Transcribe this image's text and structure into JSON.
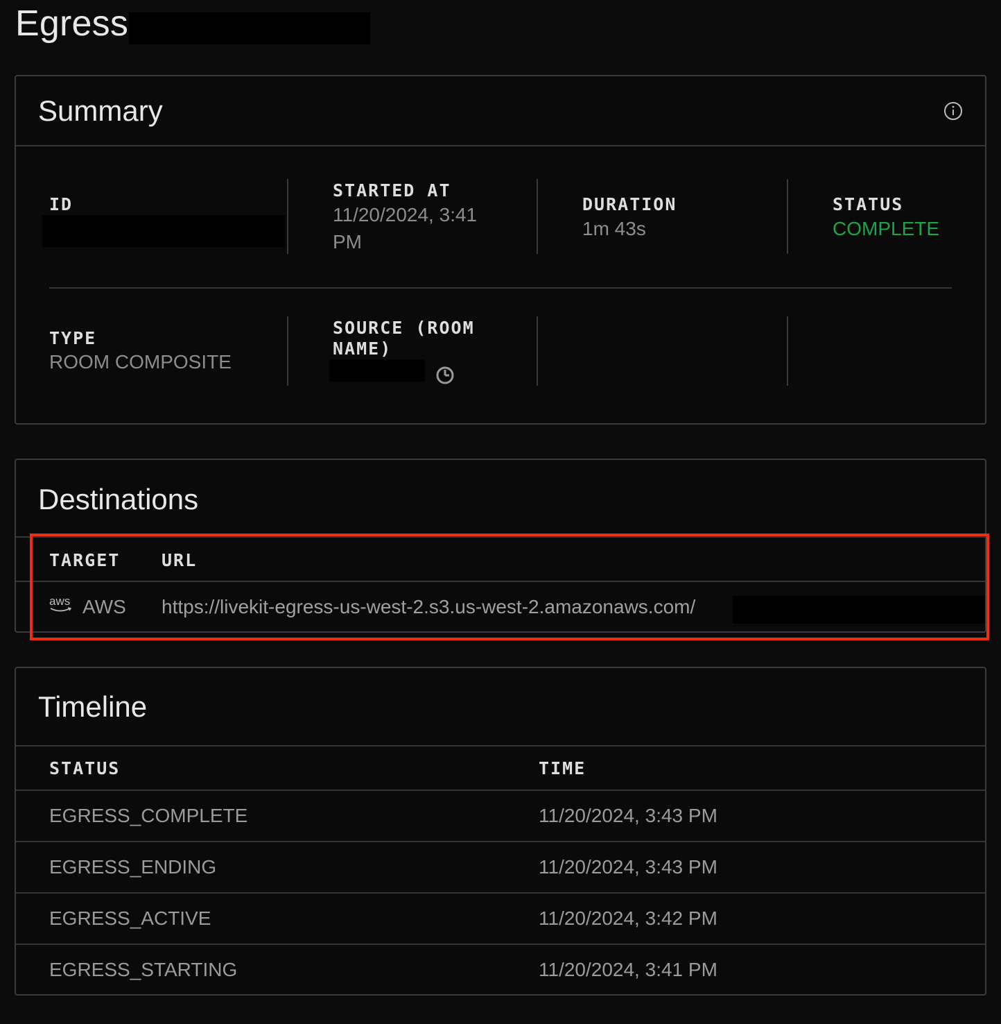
{
  "header": {
    "title": "Egress"
  },
  "summary": {
    "title": "Summary",
    "info_icon": "info-icon",
    "id_label": "ID",
    "started_label": "STARTED AT",
    "started_value_line1": "11/20/2024, 3:41",
    "started_value_line2": "PM",
    "duration_label": "DURATION",
    "duration_value": "1m 43s",
    "status_label": "STATUS",
    "status_value": "COMPLETE",
    "status_color": "#1fa34a",
    "type_label": "TYPE",
    "type_value": "ROOM COMPOSITE",
    "source_label_line1": "SOURCE (ROOM",
    "source_label_line2": "NAME)",
    "source_icon": "clock-icon"
  },
  "destinations": {
    "title": "Destinations",
    "columns": [
      "TARGET",
      "URL"
    ],
    "rows": [
      {
        "logo": "aws",
        "target": "AWS",
        "url": "https://livekit-egress-us-west-2.s3.us-west-2.amazonaws.com/"
      }
    ]
  },
  "timeline": {
    "title": "Timeline",
    "columns": [
      "STATUS",
      "TIME"
    ],
    "rows": [
      {
        "status": "EGRESS_COMPLETE",
        "time": "11/20/2024, 3:43 PM"
      },
      {
        "status": "EGRESS_ENDING",
        "time": "11/20/2024, 3:43 PM"
      },
      {
        "status": "EGRESS_ACTIVE",
        "time": "11/20/2024, 3:42 PM"
      },
      {
        "status": "EGRESS_STARTING",
        "time": "11/20/2024, 3:41 PM"
      }
    ]
  },
  "colors": {
    "highlight": "#ee2a18",
    "background": "#0b0b0b"
  }
}
